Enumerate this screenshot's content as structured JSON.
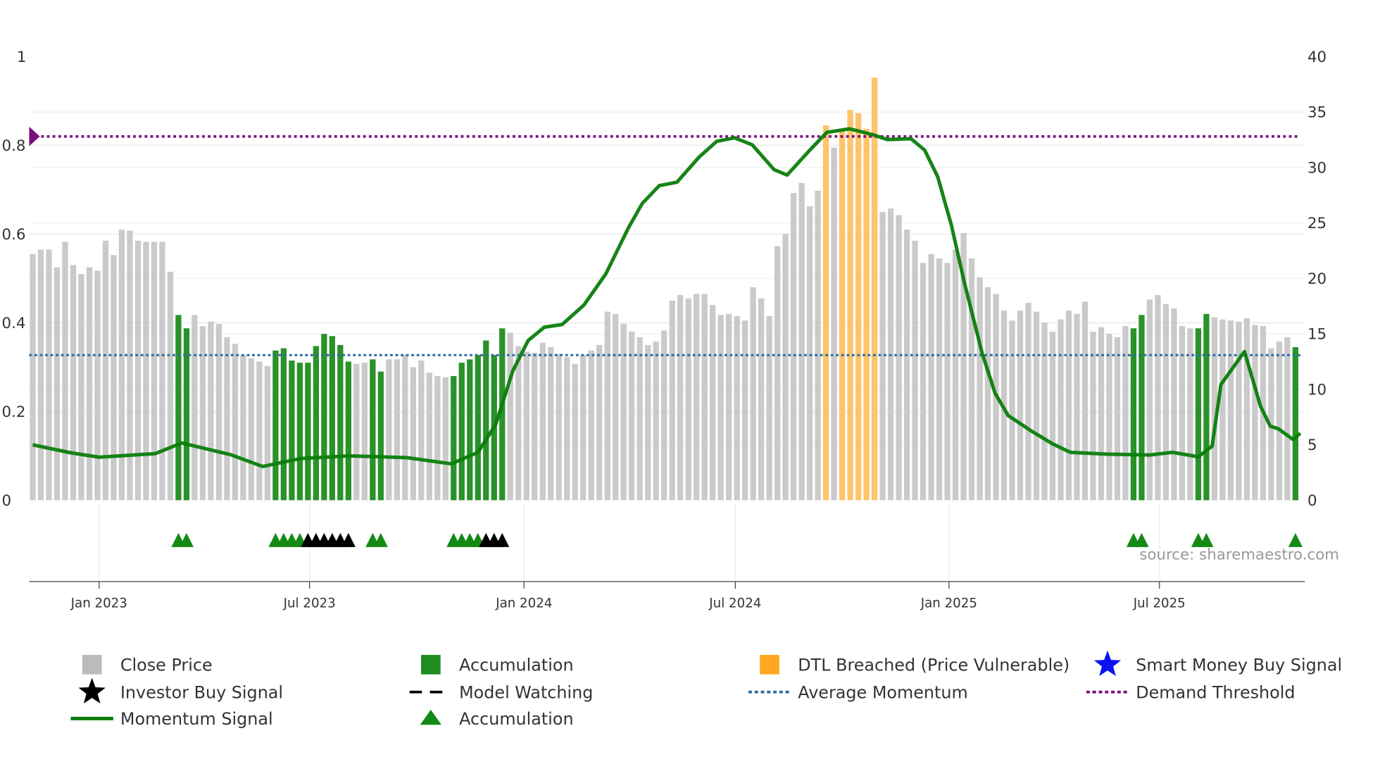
{
  "chart_data": {
    "type": "bar",
    "title": "",
    "source": "source: sharemaestro.com",
    "left_axis": {
      "range": [
        0,
        1
      ],
      "ticks": [
        "0",
        "0.2",
        "0.4",
        "0.6",
        "0.8",
        "1"
      ],
      "tick_values": [
        0,
        0.2,
        0.4,
        0.6,
        0.8,
        1
      ]
    },
    "right_axis": {
      "range": [
        0,
        40
      ],
      "ticks": [
        "0",
        "5",
        "10",
        "15",
        "20",
        "25",
        "30",
        "35",
        "40"
      ],
      "tick_values": [
        0,
        5,
        10,
        15,
        20,
        25,
        30,
        35,
        40
      ]
    },
    "x_ticks": [
      {
        "label": "Jan 2023",
        "index": 9.2
      },
      {
        "label": "Jul 2023",
        "index": 35.2
      },
      {
        "label": "Jan 2024",
        "index": 61.7
      },
      {
        "label": "Jul 2024",
        "index": 87.8
      },
      {
        "label": "Jan 2025",
        "index": 114.2
      },
      {
        "label": "Jul 2025",
        "index": 140.2
      }
    ],
    "close_price": [
      22.2,
      22.6,
      22.6,
      21.0,
      23.3,
      21.2,
      20.4,
      21.0,
      20.7,
      23.4,
      22.1,
      24.4,
      24.3,
      23.4,
      23.3,
      23.3,
      23.3,
      20.6,
      16.7,
      15.5,
      16.7,
      15.7,
      16.1,
      15.9,
      14.7,
      14.1,
      13.1,
      12.8,
      12.5,
      12.1,
      13.5,
      13.7,
      12.6,
      12.4,
      12.4,
      13.9,
      15.0,
      14.8,
      14.0,
      12.5,
      12.3,
      12.4,
      12.7,
      11.6,
      12.7,
      12.7,
      13.1,
      12.0,
      12.6,
      11.5,
      11.2,
      11.1,
      11.2,
      12.4,
      12.7,
      13.1,
      14.4,
      13.1,
      15.5,
      15.1,
      13.9,
      13.4,
      13.3,
      14.2,
      13.8,
      13.2,
      12.9,
      12.3,
      13.1,
      13.5,
      14.0,
      17.0,
      16.8,
      15.9,
      15.2,
      14.7,
      14.0,
      14.3,
      15.3,
      18.0,
      18.5,
      18.2,
      18.6,
      18.6,
      17.6,
      16.7,
      16.8,
      16.6,
      16.2,
      19.2,
      18.2,
      16.6,
      22.9,
      24.0,
      27.7,
      28.6,
      26.5,
      27.9,
      33.8,
      31.8,
      33.4,
      35.2,
      34.9,
      33.5,
      38.1,
      26.0,
      26.3,
      25.7,
      24.4,
      23.4,
      21.4,
      22.2,
      21.8,
      21.4,
      22.6,
      24.1,
      21.8,
      20.1,
      19.2,
      18.6,
      17.1,
      16.2,
      17.1,
      17.8,
      17.0,
      16.0,
      15.2,
      16.3,
      17.1,
      16.8,
      17.9,
      15.2,
      15.6,
      15.0,
      14.7,
      15.7,
      15.5,
      16.7,
      18.1,
      18.5,
      17.7,
      17.3,
      15.7,
      15.5,
      15.5,
      16.8,
      16.5,
      16.3,
      16.2,
      16.1,
      16.4,
      15.8,
      15.7,
      13.7,
      14.3,
      14.7,
      13.8
    ],
    "accumulation_bars": [
      19,
      20,
      31,
      32,
      33,
      34,
      35,
      36,
      37,
      38,
      39,
      40,
      43,
      44,
      53,
      54,
      55,
      56,
      57,
      58,
      59,
      137,
      138,
      145,
      146,
      157
    ],
    "dtl_breached_bars": [
      99,
      101,
      102,
      103,
      104,
      105
    ],
    "momentum_signal": [
      [
        1,
        0.125
      ],
      [
        5.7,
        0.107
      ],
      [
        9.2,
        0.097
      ],
      [
        16.1,
        0.105
      ],
      [
        19.4,
        0.129
      ],
      [
        25.4,
        0.103
      ],
      [
        29.4,
        0.076
      ],
      [
        34.1,
        0.094
      ],
      [
        40.1,
        0.1
      ],
      [
        47.2,
        0.096
      ],
      [
        52.7,
        0.082
      ],
      [
        56,
        0.108
      ],
      [
        58.2,
        0.171
      ],
      [
        60.3,
        0.291
      ],
      [
        62.2,
        0.36
      ],
      [
        64.2,
        0.39
      ],
      [
        66.4,
        0.396
      ],
      [
        69.1,
        0.44
      ],
      [
        71.8,
        0.51
      ],
      [
        74.6,
        0.614
      ],
      [
        76.3,
        0.669
      ],
      [
        78.4,
        0.709
      ],
      [
        80.6,
        0.717
      ],
      [
        83.3,
        0.773
      ],
      [
        85.5,
        0.809
      ],
      [
        87.7,
        0.817
      ],
      [
        89.9,
        0.801
      ],
      [
        92.6,
        0.745
      ],
      [
        94.2,
        0.733
      ],
      [
        97,
        0.789
      ],
      [
        99.1,
        0.829
      ],
      [
        101.9,
        0.837
      ],
      [
        104.6,
        0.825
      ],
      [
        106.6,
        0.813
      ],
      [
        109.5,
        0.815
      ],
      [
        111.2,
        0.789
      ],
      [
        112.8,
        0.729
      ],
      [
        114.5,
        0.62
      ],
      [
        116.1,
        0.49
      ],
      [
        118.3,
        0.331
      ],
      [
        119.9,
        0.241
      ],
      [
        121.5,
        0.191
      ],
      [
        124.3,
        0.157
      ],
      [
        127,
        0.127
      ],
      [
        129.2,
        0.108
      ],
      [
        133.6,
        0.104
      ],
      [
        139,
        0.102
      ],
      [
        141.8,
        0.108
      ],
      [
        145,
        0.098
      ],
      [
        146.7,
        0.122
      ],
      [
        147.8,
        0.261
      ],
      [
        150.7,
        0.335
      ],
      [
        152.7,
        0.211
      ],
      [
        153.9,
        0.167
      ],
      [
        154.9,
        0.161
      ],
      [
        156.7,
        0.137
      ],
      [
        157.6,
        0.151
      ]
    ],
    "average_momentum": 0.327,
    "demand_threshold": 0.82,
    "accumulation_markers": [
      19,
      20,
      31,
      32,
      33,
      34,
      43,
      44,
      53,
      54,
      55,
      56,
      137,
      138,
      145,
      146,
      157
    ],
    "investor_buy_markers": [
      35,
      36,
      37,
      38,
      39,
      40,
      57,
      58,
      59
    ],
    "colors": {
      "close": "#c4c4c4",
      "accumulation": "#2a922a",
      "dtl": "#fdc46a",
      "dtl_legend": "#ffa820",
      "momentum": "#0a7d0a",
      "average": "#2f6f9f",
      "threshold": "#7b0f7b",
      "smart_money": "#0a14f0"
    },
    "legend": [
      {
        "label": "Close Price",
        "key": "close-price"
      },
      {
        "label": "Accumulation",
        "key": "accumulation-bar"
      },
      {
        "label": "DTL Breached (Price Vulnerable)",
        "key": "dtl-breached"
      },
      {
        "label": "Smart Money Buy Signal",
        "key": "smart-money"
      },
      {
        "label": "Investor Buy Signal",
        "key": "investor-buy"
      },
      {
        "label": "Model Watching",
        "key": "model-watching"
      },
      {
        "label": "Average Momentum",
        "key": "average-momentum"
      },
      {
        "label": "Demand Threshold",
        "key": "demand-threshold"
      },
      {
        "label": "Momentum Signal",
        "key": "momentum-signal"
      },
      {
        "label": "Accumulation",
        "key": "accumulation-marker"
      }
    ]
  }
}
